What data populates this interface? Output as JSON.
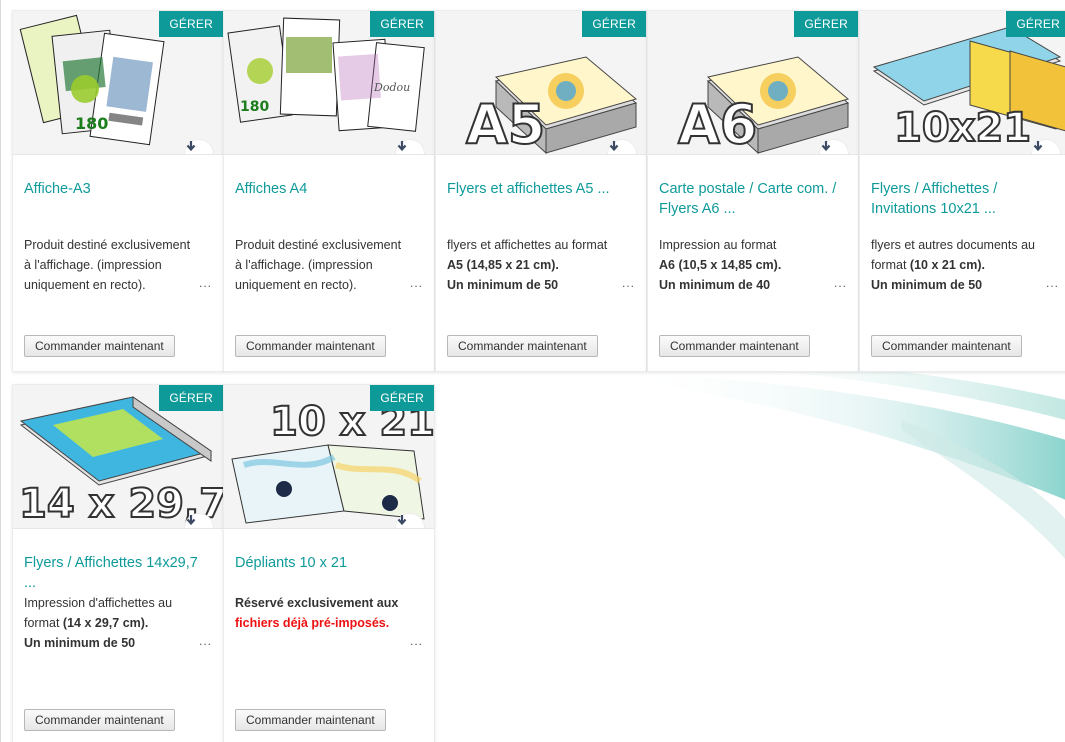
{
  "colors": {
    "accent": "#0f9a9a",
    "warning_text": "#ee1111"
  },
  "common": {
    "manage_label": "GÉRER",
    "order_label": "Commander maintenant",
    "more_label": "...",
    "download_icon": "arrow-down-icon"
  },
  "products": [
    {
      "title": "Affiche-A3",
      "thumb_text": "",
      "desc_plain": "Produit destiné exclusivement à l'affichage. (impression uniquement en recto).",
      "desc_line1": "",
      "desc_bold1": "",
      "desc_line2": "",
      "desc_bold2": "",
      "desc_red": ""
    },
    {
      "title": "Affiches A4",
      "thumb_text": "",
      "desc_plain": "Produit destiné exclusivement à l'affichage. (impression uniquement en recto).",
      "desc_line1": "",
      "desc_bold1": "",
      "desc_line2": "",
      "desc_bold2": "",
      "desc_red": ""
    },
    {
      "title": "Flyers et affichettes A5 ...",
      "thumb_text": "A5",
      "desc_plain": "",
      "desc_line1": "flyers et affichettes au format",
      "desc_bold1": "A5 (14,85 x 21 cm).",
      "desc_line2": "",
      "desc_bold2": "Un minimum de 50",
      "desc_red": ""
    },
    {
      "title": "Carte postale / Carte com. / Flyers A6 ...",
      "thumb_text": "A6",
      "desc_plain": "",
      "desc_line1": "Impression au format",
      "desc_bold1": "A6 (10,5 x 14,85 cm).",
      "desc_line2": "",
      "desc_bold2": "Un minimum de 40",
      "desc_red": ""
    },
    {
      "title": "Flyers / Affichettes / Invitations 10x21 ...",
      "thumb_text": "10x21",
      "desc_plain": "",
      "desc_line1": "flyers et autres documents au format",
      "desc_bold1": "(10 x 21 cm).",
      "desc_line2": "",
      "desc_bold2": "Un minimum de 50",
      "desc_red": ""
    },
    {
      "title": "Flyers / Affichettes 14x29,7 ...",
      "thumb_text": "14 x 29,7",
      "desc_plain": "",
      "desc_line1": "Impression d'affichettes au format",
      "desc_bold1": "(14 x 29,7 cm).",
      "desc_line2": "",
      "desc_bold2": "Un minimum de 50",
      "desc_red": ""
    },
    {
      "title": "Dépliants 10 x 21",
      "thumb_text": "10 x 21",
      "desc_plain": "",
      "desc_line1": "",
      "desc_bold1": "Réservé exclusivement aux",
      "desc_line2": "",
      "desc_bold2": "",
      "desc_red": "fichiers déjà pré-imposés."
    }
  ]
}
